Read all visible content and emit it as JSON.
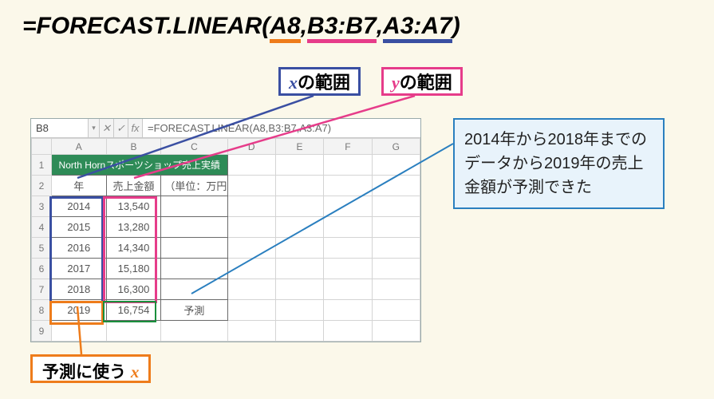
{
  "formula": {
    "prefix": "=FORECAST.LINEAR(",
    "arg1": "A8",
    "arg2": "B3:B7",
    "arg3": "A3:A7",
    "sep": ",",
    "suffix": ")"
  },
  "labels": {
    "x_range": "の範囲",
    "x_range_var": "x",
    "y_range": "の範囲",
    "y_range_var": "y",
    "pred_x_prefix": "予測に使う ",
    "pred_x_var": "x"
  },
  "explain": "2014年から2018年までのデータから2019年の売上金額が予測できた",
  "sheet": {
    "namebox": "B8",
    "fx": "fx",
    "dd_glyph": "▾",
    "check_glyph": "✓",
    "x_glyph": "✕",
    "formula_text": "=FORECAST.LINEAR(A8,B3:B7,A3:A7)",
    "cols": [
      "A",
      "B",
      "C",
      "D",
      "E",
      "F",
      "G"
    ],
    "rows": [
      "1",
      "2",
      "3",
      "4",
      "5",
      "6",
      "7",
      "8",
      "9"
    ],
    "title": "North Hornスポーツショップ売上実績",
    "headers": {
      "year": "年",
      "amount": "売上金額",
      "unit": "（単位：万円）"
    },
    "data": [
      {
        "year": "2014",
        "amount": "13,540"
      },
      {
        "year": "2015",
        "amount": "13,280"
      },
      {
        "year": "2016",
        "amount": "14,340"
      },
      {
        "year": "2017",
        "amount": "15,180"
      },
      {
        "year": "2018",
        "amount": "16,300"
      }
    ],
    "forecast": {
      "year": "2019",
      "amount": "16,754",
      "label": "予測"
    }
  },
  "chart_data": {
    "type": "table",
    "title": "North Hornスポーツショップ売上実績",
    "xlabel": "年",
    "ylabel": "売上金額（万円）",
    "x": [
      2014,
      2015,
      2016,
      2017,
      2018
    ],
    "y": [
      13540,
      13280,
      14340,
      15180,
      16300
    ],
    "forecast": {
      "x": 2019,
      "y": 16754,
      "method": "FORECAST.LINEAR"
    }
  }
}
